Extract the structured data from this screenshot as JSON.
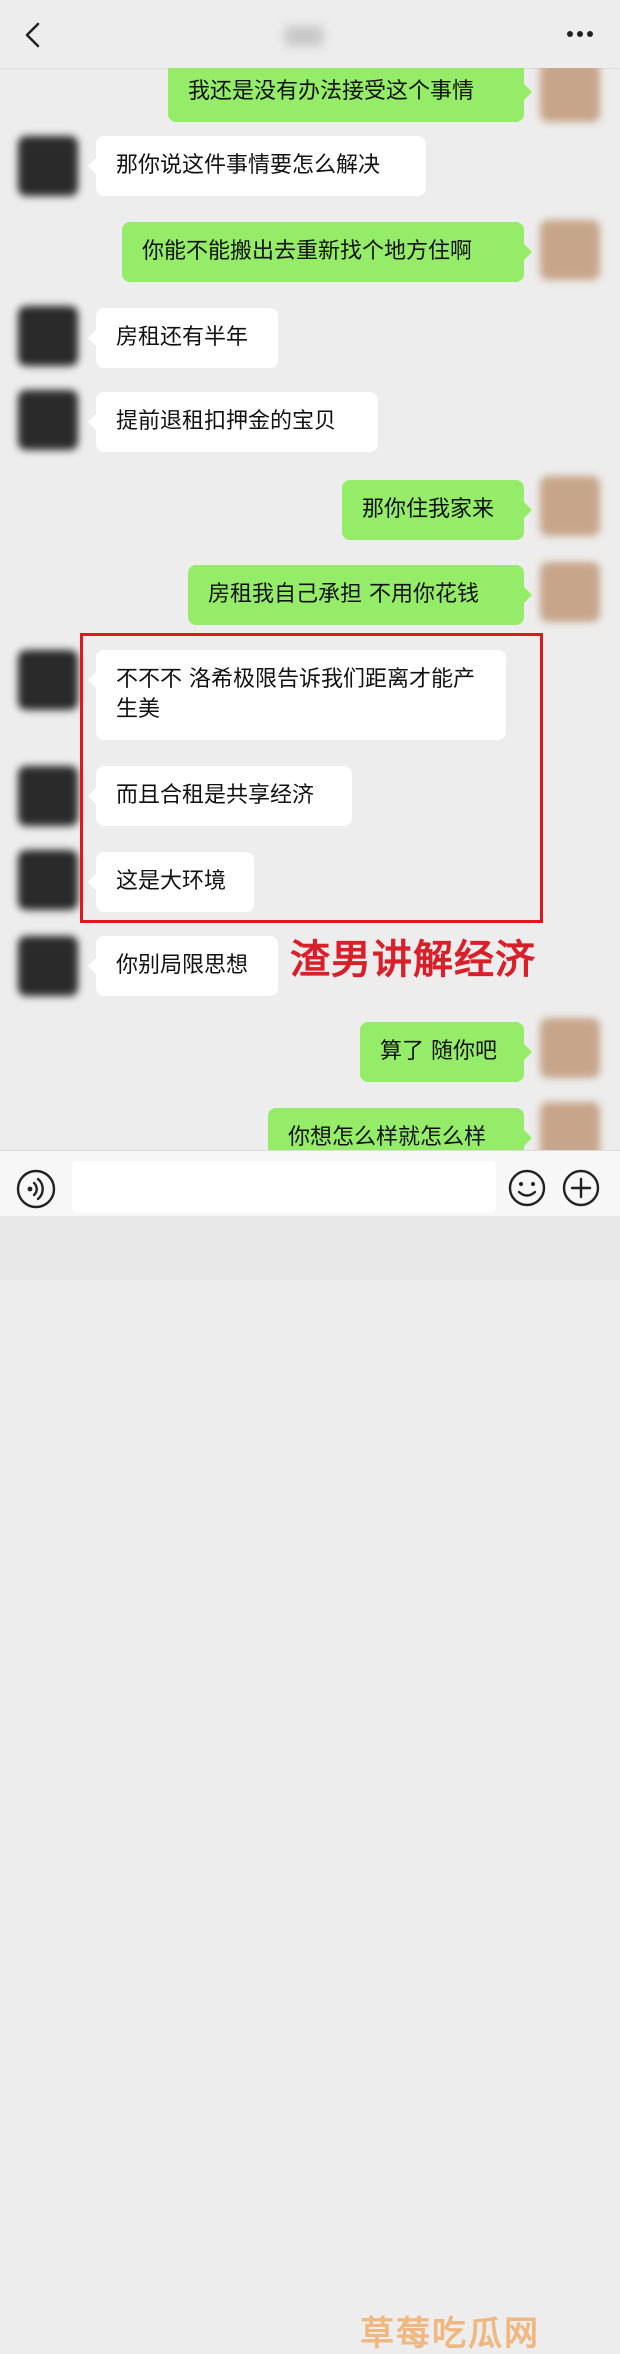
{
  "header": {
    "back_icon": "chevron-left-icon",
    "more_icon": "ellipsis-icon"
  },
  "messages": [
    {
      "from": "me",
      "text": "我还是没有办法接受这个事情"
    },
    {
      "from": "other",
      "text": "那你说这件事情要怎么解决"
    },
    {
      "from": "me",
      "text": "你能不能搬出去重新找个地方住啊"
    },
    {
      "from": "other",
      "text": "房租还有半年"
    },
    {
      "from": "other",
      "text": "提前退租扣押金的宝贝"
    },
    {
      "from": "me",
      "text": "那你住我家来"
    },
    {
      "from": "me",
      "text": "房租我自己承担 不用你花钱"
    },
    {
      "from": "other",
      "text": "不不不 洛希极限告诉我们距离才能产生美"
    },
    {
      "from": "other",
      "text": "而且合租是共享经济"
    },
    {
      "from": "other",
      "text": "这是大环境"
    },
    {
      "from": "other",
      "text": "你别局限思想"
    },
    {
      "from": "me",
      "text": "算了 随你吧"
    },
    {
      "from": "me",
      "text": "你想怎么样就怎么样"
    }
  ],
  "annotation": {
    "text": "渣男讲解经济",
    "color": "#d8202a"
  },
  "input_bar": {
    "voice_icon": "voice-icon",
    "emoji_icon": "emoji-icon",
    "plus_icon": "plus-icon"
  },
  "watermark": "草莓吃瓜网",
  "colors": {
    "outgoing_bubble": "#95ec69",
    "incoming_bubble": "#ffffff",
    "background": "#ededed",
    "highlight_border": "#e0181e"
  }
}
